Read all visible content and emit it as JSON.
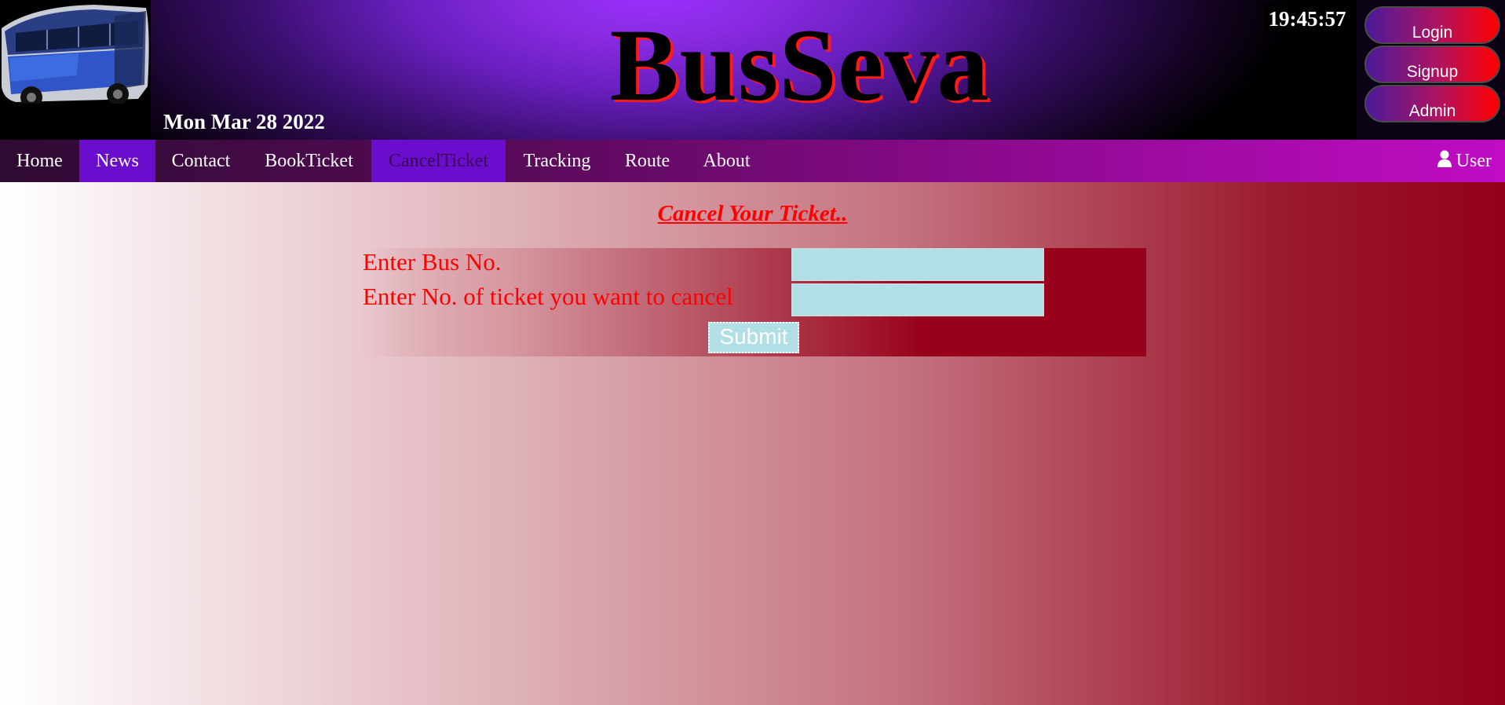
{
  "header": {
    "title": "BusSeva",
    "date": "Mon Mar 28 2022",
    "clock": "19:45:57",
    "auth_buttons": [
      "Login",
      "Signup",
      "Admin"
    ]
  },
  "nav": {
    "items": [
      "Home",
      "News",
      "Contact",
      "BookTicket",
      "CancelTicket",
      "Tracking",
      "Route",
      "About"
    ],
    "active_item": "News",
    "current_item": "CancelTicket",
    "user_label": "User"
  },
  "main": {
    "heading": "Cancel Your Ticket..",
    "form": {
      "bus_label": "Enter Bus No.",
      "bus_value": "",
      "tickets_label": "Enter No. of ticket you want to cancel",
      "tickets_value": "",
      "submit_label": "Submit"
    }
  },
  "icons": {
    "logo": "bus-photo-icon",
    "user": "user-icon"
  },
  "colors": {
    "heading": "#ff0000",
    "input_bg": "#b0e0e6",
    "nav_active": "#6a0dcc",
    "form_dark": "#97001a"
  }
}
